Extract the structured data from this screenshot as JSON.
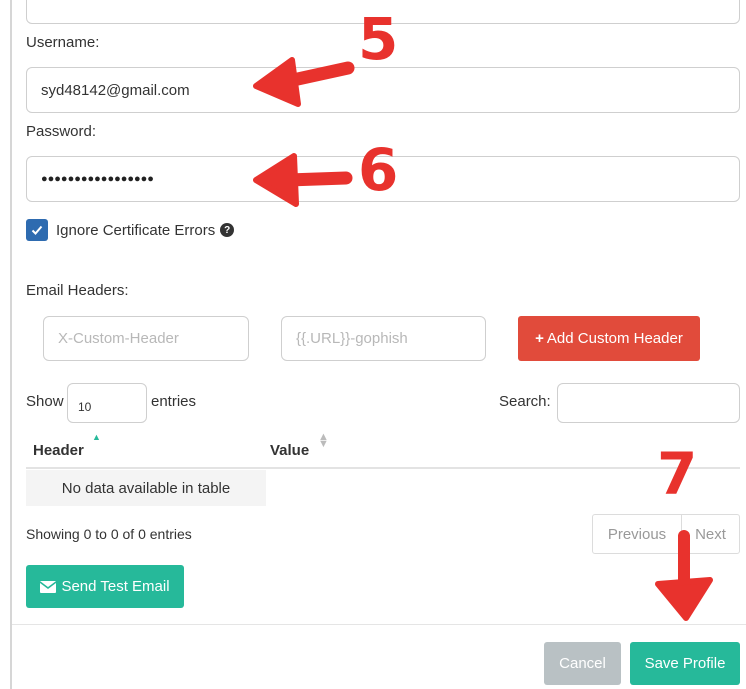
{
  "form": {
    "username_label": "Username:",
    "username_value": "syd48142@gmail.com",
    "password_label": "Password:",
    "password_value": "●●●●●●●●●●●●●●●●●",
    "ignore_cert_label": "Ignore Certificate Errors",
    "ignore_cert_checked": true,
    "email_headers_label": "Email Headers:",
    "header_placeholder": "X-Custom-Header",
    "value_placeholder": "{{.URL}}-gophish",
    "add_header_label": "Add Custom Header"
  },
  "table": {
    "show_label": "Show",
    "entries_value": "10",
    "entries_label": "entries",
    "search_label": "Search:",
    "columns": [
      "Header",
      "Value"
    ],
    "empty_message": "No data available in table",
    "info": "Showing 0 to 0 of 0 entries",
    "previous_label": "Previous",
    "next_label": "Next"
  },
  "actions": {
    "send_test_label": "Send Test Email",
    "cancel_label": "Cancel",
    "save_label": "Save Profile"
  },
  "annotations": {
    "step5": "5",
    "step6": "6",
    "step7": "7"
  },
  "colors": {
    "checkbox": "#2e6bb0",
    "add_header_button": "#e14b3b",
    "green_button": "#26b99a",
    "cancel_button": "#b9c1c4",
    "annotation": "#e8322d"
  }
}
